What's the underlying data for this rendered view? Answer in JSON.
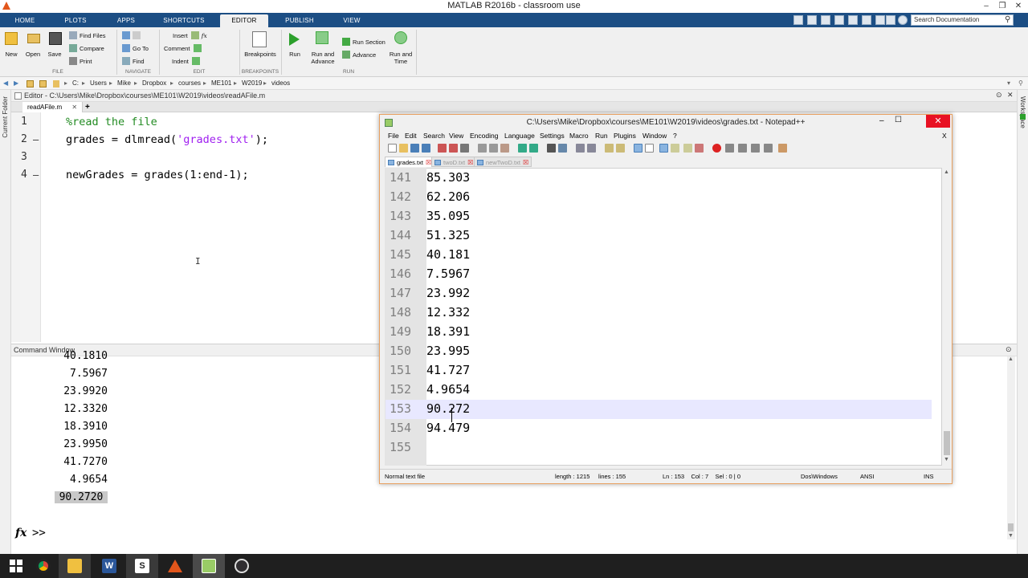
{
  "matlab": {
    "window_title": "MATLAB R2016b - classroom use",
    "tabs": [
      "HOME",
      "PLOTS",
      "APPS",
      "SHORTCUTS",
      "EDITOR",
      "PUBLISH",
      "VIEW"
    ],
    "active_tab": "EDITOR",
    "search_placeholder": "Search Documentation",
    "ribbon": {
      "file": {
        "group_label": "FILE",
        "new": "New",
        "open": "Open",
        "save": "Save",
        "find_files": "Find Files",
        "compare": "Compare",
        "print": "Print"
      },
      "navigate": {
        "group_label": "NAVIGATE",
        "go_to": "Go To",
        "find": "Find"
      },
      "edit": {
        "group_label": "EDIT",
        "insert": "Insert",
        "comment": "Comment",
        "indent": "Indent",
        "fx": "fx"
      },
      "breakpoints": {
        "group_label": "BREAKPOINTS",
        "breakpoints": "Breakpoints"
      },
      "run": {
        "group_label": "RUN",
        "run": "Run",
        "run_and_advance_1": "Run and",
        "run_and_advance_2": "Advance",
        "run_section": "Run Section",
        "advance": "Advance",
        "run_and_time_1": "Run and",
        "run_and_time_2": "Time"
      }
    },
    "address": [
      "C:",
      "Users",
      "Mike",
      "Dropbox",
      "courses",
      "ME101",
      "W2019",
      "videos"
    ],
    "left_panel_label": "Current Folder",
    "right_panel_label": "Workspace",
    "editor": {
      "header": "Editor - C:\\Users\\Mike\\Dropbox\\courses\\ME101\\W2019\\videos\\readAFile.m",
      "tab": "readAFile.m",
      "add_tab": "+",
      "lines": [
        {
          "num": "1",
          "marker": "",
          "parts": [
            {
              "text": "%read the file",
              "kind": "comment"
            }
          ]
        },
        {
          "num": "2",
          "marker": "—",
          "parts": [
            {
              "text": "grades = dlmread(",
              "kind": "plain"
            },
            {
              "text": "'grades.txt'",
              "kind": "string"
            },
            {
              "text": ");",
              "kind": "plain"
            }
          ]
        },
        {
          "num": "3",
          "marker": "",
          "parts": []
        },
        {
          "num": "4",
          "marker": "—",
          "parts": [
            {
              "text": "newGrades = grades(1:end-1);",
              "kind": "plain"
            }
          ]
        }
      ]
    },
    "command_window": {
      "title": "Command Window",
      "values": [
        "40.1810",
        "7.5967",
        "23.9920",
        "12.3320",
        "18.3910",
        "23.9950",
        "41.7270",
        "4.9654",
        "90.2720"
      ],
      "prompt": ">>",
      "fx": "fx"
    }
  },
  "notepad": {
    "title": "C:\\Users\\Mike\\Dropbox\\courses\\ME101\\W2019\\videos\\grades.txt - Notepad++",
    "menu": [
      "File",
      "Edit",
      "Search",
      "View",
      "Encoding",
      "Language",
      "Settings",
      "Macro",
      "Run",
      "Plugins",
      "Window",
      "?"
    ],
    "close_x": "X",
    "tabs": [
      "grades.txt",
      "twoD.txt",
      "newTwoD.txt"
    ],
    "active_tab": "grades.txt",
    "lines": [
      {
        "num": "141",
        "value": "85.303"
      },
      {
        "num": "142",
        "value": "62.206"
      },
      {
        "num": "143",
        "value": "35.095"
      },
      {
        "num": "144",
        "value": "51.325"
      },
      {
        "num": "145",
        "value": "40.181"
      },
      {
        "num": "146",
        "value": "7.5967"
      },
      {
        "num": "147",
        "value": "23.992"
      },
      {
        "num": "148",
        "value": "12.332"
      },
      {
        "num": "149",
        "value": "18.391"
      },
      {
        "num": "150",
        "value": "23.995"
      },
      {
        "num": "151",
        "value": "41.727"
      },
      {
        "num": "152",
        "value": "4.9654"
      },
      {
        "num": "153",
        "value": "90.272"
      },
      {
        "num": "154",
        "value": "94.479"
      },
      {
        "num": "155",
        "value": ""
      }
    ],
    "current_line": "153",
    "status": {
      "type": "Normal text file",
      "length": "length : 1215",
      "lines": "lines : 155",
      "position": "Ln : 153    Col : 7    Sel : 0 | 0",
      "eol": "Dos\\Windows",
      "encoding": "ANSI",
      "mode": "INS"
    }
  },
  "taskbar": {
    "apps": [
      "windows-start",
      "chrome",
      "file-explorer",
      "word",
      "skype",
      "matlab",
      "notepad-plus-plus",
      "obs"
    ]
  },
  "colors": {
    "ribbon_tab_bg": "#1c4e84",
    "comment": "#228b22",
    "string": "#a020f0",
    "npp_current_line": "#e8e8ff",
    "npp_close": "#e81123"
  }
}
